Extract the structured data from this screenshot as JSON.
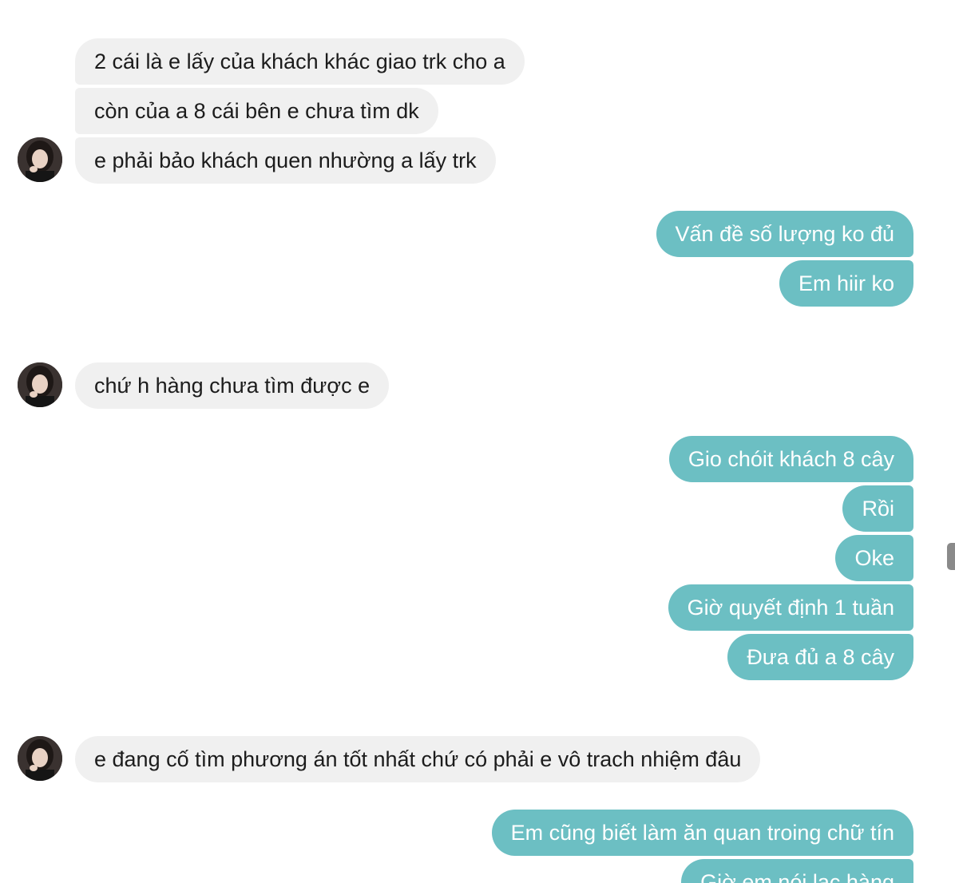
{
  "conversation": {
    "messages": [
      {
        "side": "in",
        "text": "2 cái là e lấy của khách khác giao trk cho a"
      },
      {
        "side": "in",
        "text": "còn của a 8 cái bên e chưa tìm dk"
      },
      {
        "side": "in",
        "text": "e phải bảo khách quen nhường a lấy trk"
      },
      {
        "side": "out",
        "text": "Vấn đề số lượng ko đủ"
      },
      {
        "side": "out",
        "text": "Em hiir ko"
      },
      {
        "side": "in",
        "text": "chứ h hàng chưa tìm được e"
      },
      {
        "side": "out",
        "text": "Gio chóit khách 8 cây"
      },
      {
        "side": "out",
        "text": "Rồi"
      },
      {
        "side": "out",
        "text": "Oke"
      },
      {
        "side": "out",
        "text": "Giờ quyết định 1 tuần"
      },
      {
        "side": "out",
        "text": "Đưa đủ a 8 cây"
      },
      {
        "side": "in",
        "text": "e đang cố tìm phương án tốt nhất chứ có phải e vô trach nhiệm đâu"
      },
      {
        "side": "out",
        "text": "Em cũng biết làm ăn quan troing chữ tín"
      },
      {
        "side": "out",
        "text": "Giờ em nói lạc hàng"
      }
    ]
  },
  "colors": {
    "incoming_bubble": "#f0f0f0",
    "outgoing_bubble": "#6cbfc3",
    "incoming_text": "#1c1c1c",
    "outgoing_text": "#ffffff"
  }
}
